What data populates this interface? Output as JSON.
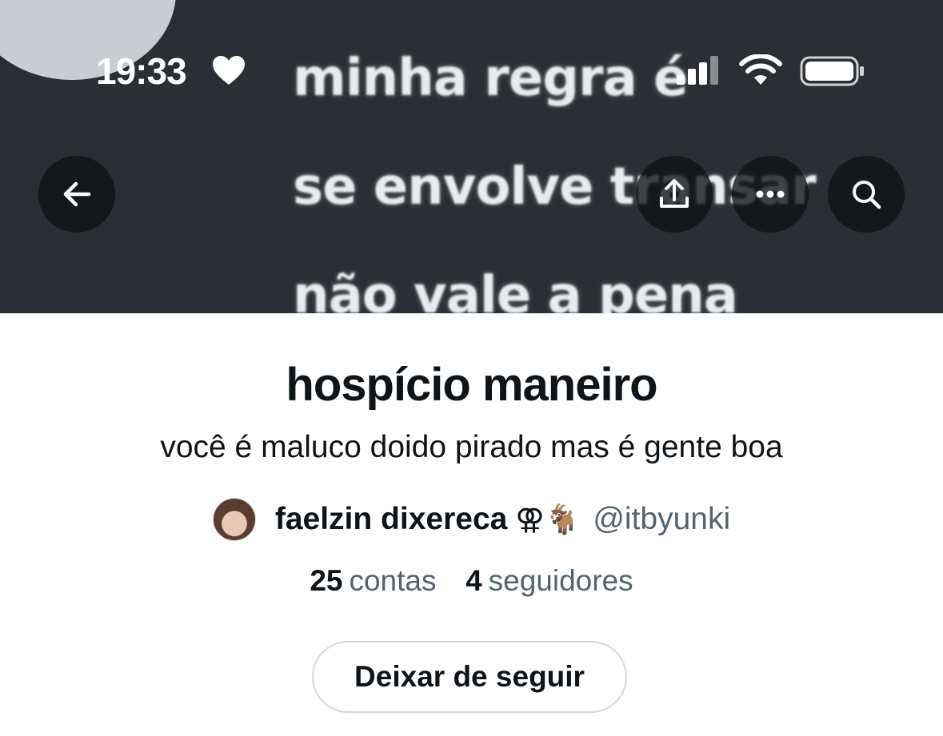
{
  "status_bar": {
    "time": "19:33",
    "heart_icon": "heart-icon",
    "signal_icon": "cellular-signal-icon",
    "wifi_icon": "wifi-icon",
    "battery_icon": "battery-icon"
  },
  "banner": {
    "caption_lines": [
      "minha regra é",
      "se envolve transar",
      "não vale a pena"
    ]
  },
  "header": {
    "back_icon": "arrow-left-icon",
    "share_icon": "share-icon",
    "more_icon": "more-horizontal-icon",
    "search_icon": "search-icon"
  },
  "list": {
    "title": "hospício maneiro",
    "description": "você é maluco doido pirado mas é gente boa",
    "owner": {
      "name": "faelzin dixereca",
      "emoji": "⚢🐐",
      "handle": "@itbyunki"
    },
    "stats": {
      "members_count": "25",
      "members_label": "contas",
      "followers_count": "4",
      "followers_label": "seguidores"
    },
    "unfollow_label": "Deixar de seguir"
  },
  "colors": {
    "text_primary": "#0f1419",
    "text_secondary": "#536471",
    "banner_bg": "#2b2f33",
    "button_border": "#cfd9de"
  }
}
